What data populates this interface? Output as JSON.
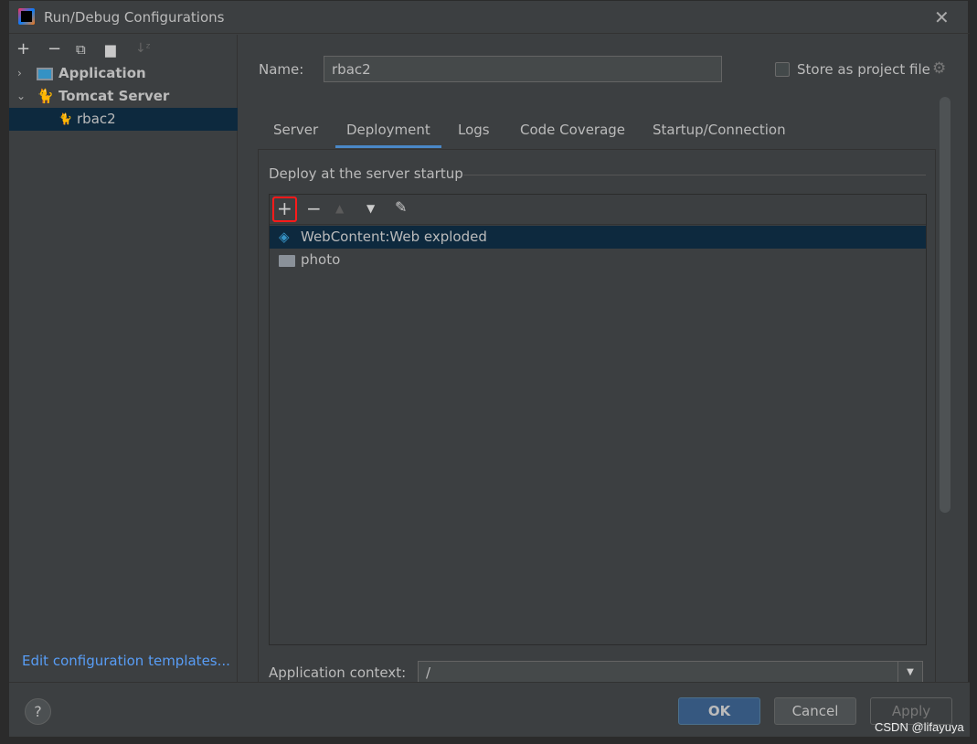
{
  "dialog": {
    "title": "Run/Debug Configurations"
  },
  "sidebar": {
    "tree": [
      {
        "label": "Application",
        "expanded": false
      },
      {
        "label": "Tomcat Server",
        "expanded": true
      },
      {
        "label": "rbac2",
        "selected": true
      }
    ],
    "edit_templates": "Edit configuration templates..."
  },
  "form": {
    "name_label": "Name:",
    "name_value": "rbac2",
    "store_label": "Store as project file",
    "store_checked": false
  },
  "tabs": [
    {
      "label": "Server"
    },
    {
      "label": "Deployment",
      "active": true
    },
    {
      "label": "Logs"
    },
    {
      "label": "Code Coverage"
    },
    {
      "label": "Startup/Connection"
    }
  ],
  "deployment": {
    "section": "Deploy at the server startup",
    "items": [
      {
        "label": "WebContent:Web exploded",
        "icon": "web-artifact-icon",
        "selected": true
      },
      {
        "label": "photo",
        "icon": "folder-icon"
      }
    ],
    "context_label": "Application context:",
    "context_value": "/"
  },
  "buttons": {
    "ok": "OK",
    "cancel": "Cancel",
    "apply": "Apply",
    "help": "?"
  },
  "watermark": "CSDN @lifayuya",
  "colors": {
    "accent": "#4a88c7",
    "selection": "#0d293e",
    "highlight": "#ff0000"
  }
}
